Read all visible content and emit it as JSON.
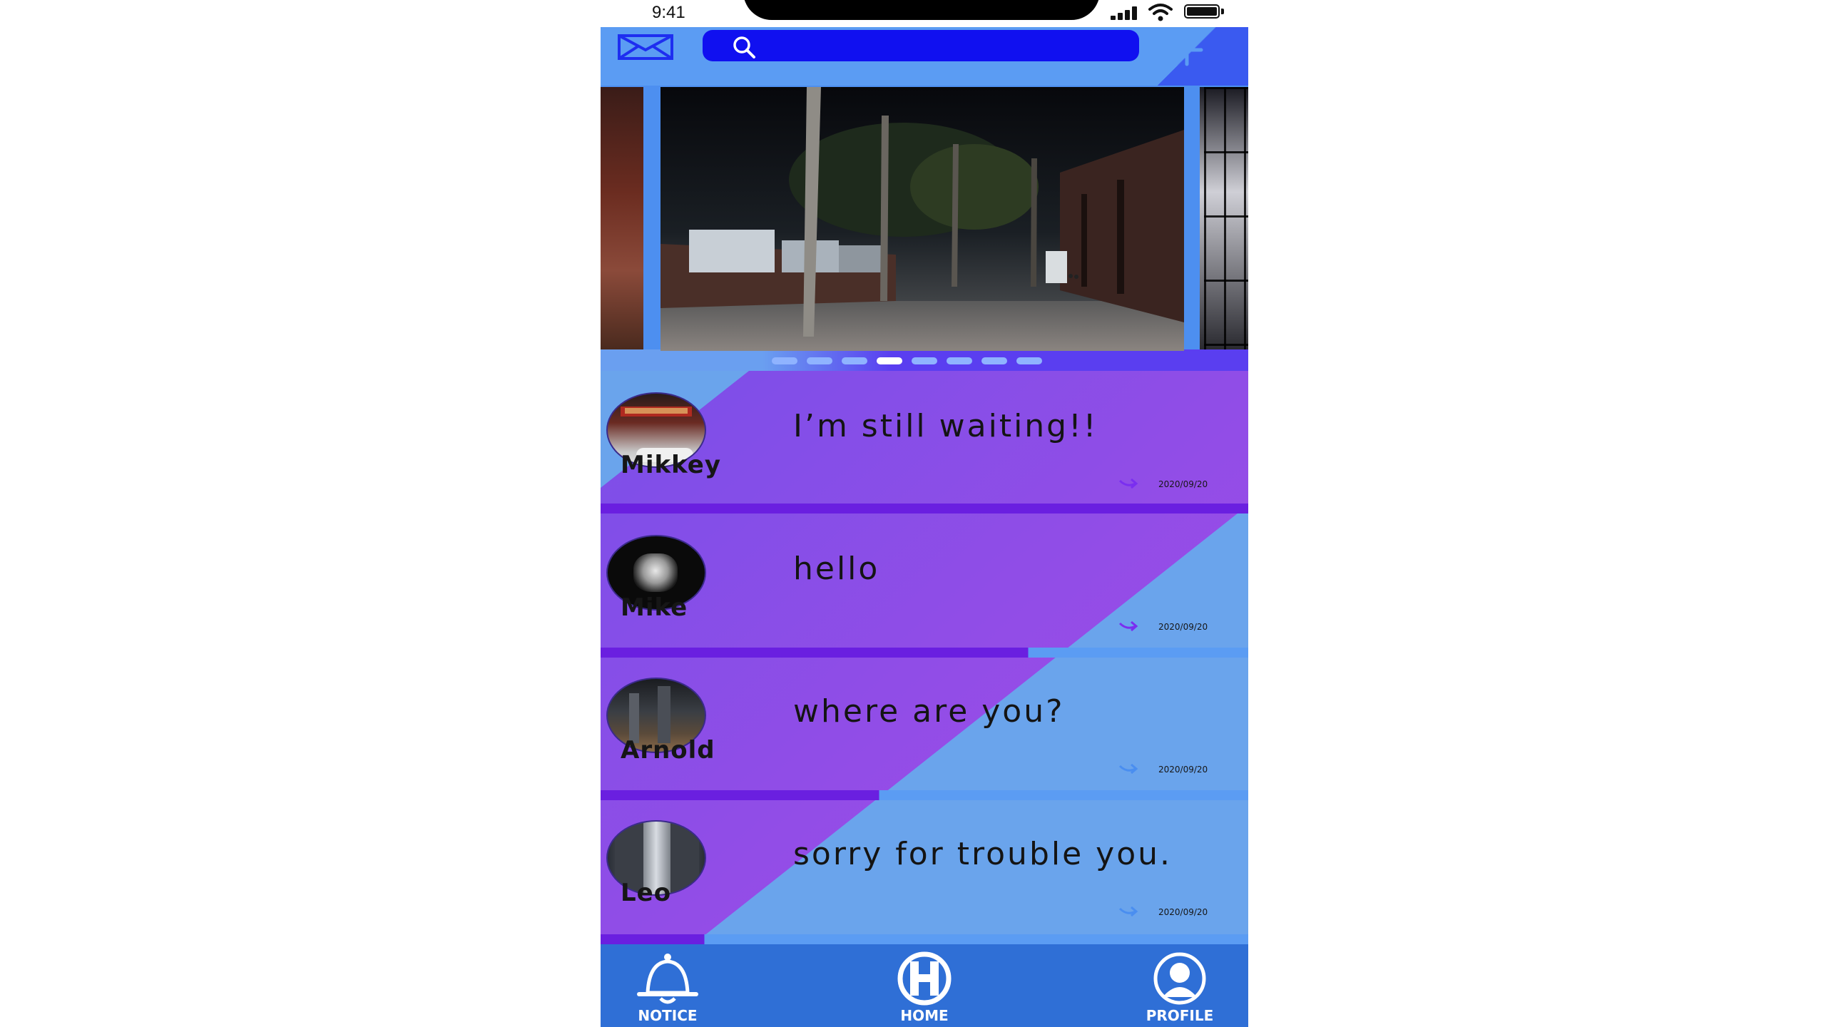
{
  "status_bar": {
    "time": "9:41"
  },
  "header": {
    "search": {
      "placeholder": ""
    },
    "icons": {
      "menu": "envelope-icon",
      "search": "search-icon",
      "add": "plus-icon"
    }
  },
  "carousel": {
    "dot_count": 8,
    "active_index": 3
  },
  "messages": [
    {
      "name": "Mikkey",
      "text": "I’m still waiting!!",
      "date": "2020/09/20"
    },
    {
      "name": "Mike",
      "text": "hello",
      "date": "2020/09/20"
    },
    {
      "name": "Arnold",
      "text": "where are you?",
      "date": "2020/09/20"
    },
    {
      "name": "Leo",
      "text": "sorry for trouble you.",
      "date": "2020/09/20"
    }
  ],
  "tab_bar": {
    "notice": "NOTICE",
    "home": "HOME",
    "profile": "PROFILE"
  },
  "colors": {
    "purple": "#9146e8",
    "blue": "#6aa4ec",
    "divider_purple": "#6a1fe0",
    "search_blue": "#1010f0",
    "tab_bar": "#2f6fd6"
  }
}
